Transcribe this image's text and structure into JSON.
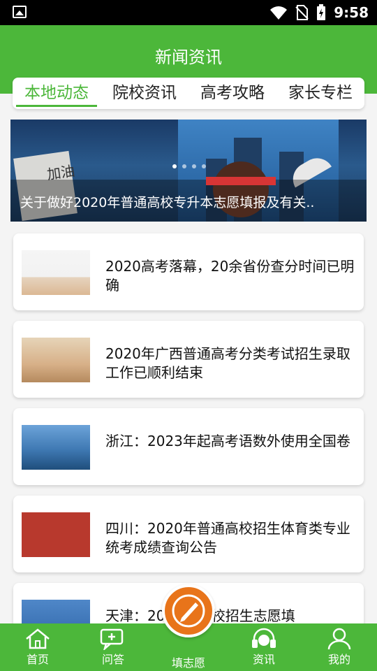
{
  "status_bar": {
    "time": "9:58"
  },
  "header": {
    "title": "新闻资讯"
  },
  "tabs": [
    {
      "label": "本地动态",
      "active": true
    },
    {
      "label": "院校资讯",
      "active": false
    },
    {
      "label": "高考攻略",
      "active": false
    },
    {
      "label": "家长专栏",
      "active": false
    }
  ],
  "banner": {
    "caption": "关于做好2020年普通高校专升本志愿填报及有关..",
    "slide_count": 4,
    "active_slide": 1,
    "image_text": "加油"
  },
  "news": [
    {
      "title": "2020高考落幕，20余省份查分时间已明确"
    },
    {
      "title": "2020年广西普通高考分类考试招生录取工作已顺利结束"
    },
    {
      "title": "浙江：2023年起高考语数外使用全国卷"
    },
    {
      "title": "四川：2020年普通高校招生体育类专业统考成绩查询公告"
    },
    {
      "title": "天津：20  普通高校招生志愿填"
    }
  ],
  "bottom_nav": [
    {
      "label": "首页",
      "icon": "home-icon"
    },
    {
      "label": "问答",
      "icon": "chat-icon"
    },
    {
      "label": "填志愿",
      "icon": "pen-icon"
    },
    {
      "label": "资讯",
      "icon": "headset-icon"
    },
    {
      "label": "我的",
      "icon": "user-icon"
    }
  ],
  "colors": {
    "primary": "#4cb73a",
    "accent": "#e8741a"
  }
}
